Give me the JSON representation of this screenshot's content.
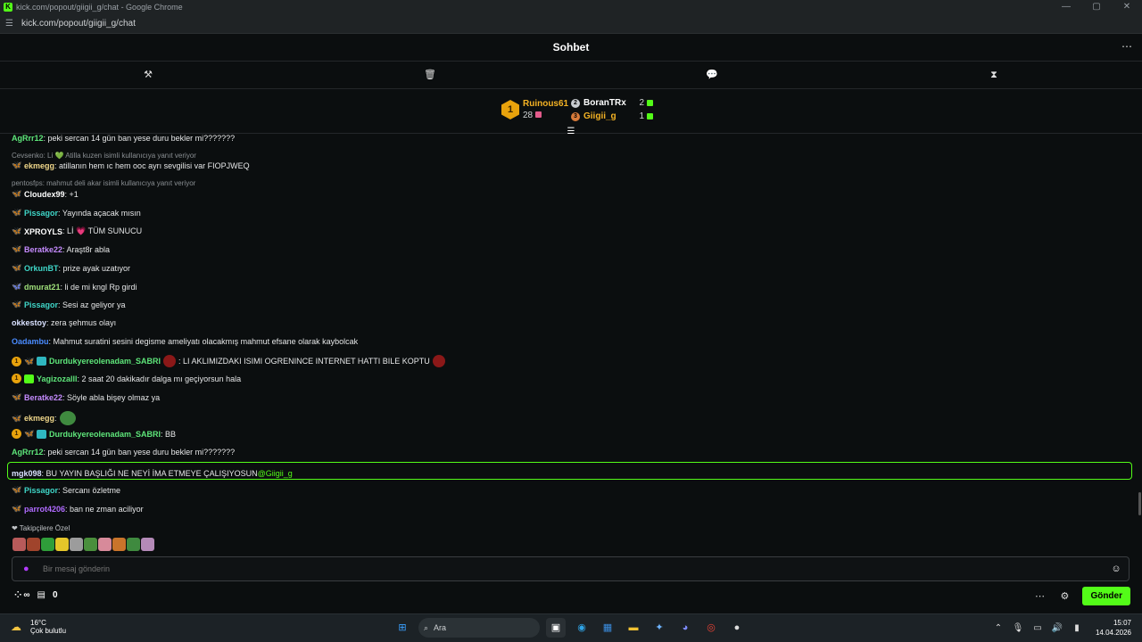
{
  "browser": {
    "title": "kick.com/popout/giigii_g/chat - Google Chrome",
    "url": "kick.com/popout/giigii_g/chat",
    "favicon_letter": "K"
  },
  "header": {
    "title": "Sohbet",
    "more": "⋯"
  },
  "toolbar": {
    "tools": [
      {
        "icon": "hammer-icon",
        "glyph": "⚒"
      },
      {
        "icon": "trash-icon",
        "glyph": "🗑"
      },
      {
        "icon": "chat-bubble-icon",
        "glyph": "💬"
      },
      {
        "icon": "hourglass-icon",
        "glyph": "⧗"
      }
    ]
  },
  "leaderboard": {
    "first": {
      "rank": "1",
      "name": "Ruinous61",
      "count": "28"
    },
    "second": {
      "name": "BoranTRx",
      "count": "2"
    },
    "third": {
      "name": "Giigii_g",
      "count": "1"
    }
  },
  "messages": [
    {
      "user": "AgRrr12",
      "color": "#5ee67a",
      "text": ": peki sercan 14 gün ban yese duru bekler mi???????",
      "badges": []
    },
    {
      "reply": "Cevsenko: Li 💚 Atilla kuzen isimli kullanıcıya yanıt veriyor"
    },
    {
      "user": "ekmegg",
      "color": "#f0d78a",
      "text": ": atillanın hem ıc hem ooc ayrı sevgilisi var FIOPJWEQ",
      "badges": [
        "fly"
      ]
    },
    {
      "reply": "pentosfps: mahmut deli akar isimli kullanıcıya yanıt veriyor"
    },
    {
      "user": "Cloudex99",
      "color": "#ffffff",
      "text": ": +1",
      "badges": [
        "fly"
      ]
    },
    {
      "user": "Pissagor",
      "color": "#3fd6c8",
      "text": ": Yayında açacak mısın",
      "badges": [
        "fly"
      ]
    },
    {
      "user": "XPROYLS",
      "color": "#ffffff",
      "text": ": Lİ 💗 TÜM SUNUCU",
      "badges": [
        "fly"
      ]
    },
    {
      "user": "Beratke22",
      "color": "#c58bff",
      "text": ": Araşt8r abla",
      "badges": [
        "fly"
      ]
    },
    {
      "user": "OrkunBT",
      "color": "#3fd6c8",
      "text": ": prize ayak uzatıyor",
      "badges": [
        "fly"
      ]
    },
    {
      "user": "dmurat21",
      "color": "#9fe07a",
      "text": ": li de mi kngl Rp girdi",
      "badges": [
        "fly-orange"
      ]
    },
    {
      "user": "Pissagor",
      "color": "#3fd6c8",
      "text": ": Sesi az geliyor ya",
      "badges": [
        "fly"
      ]
    },
    {
      "user": "okkestoy",
      "color": "#d9e1ff",
      "text": ": zera şehmus olayı",
      "badges": []
    },
    {
      "user": "Oadambu",
      "color": "#4a8cff",
      "text": ": Mahmut suratini sesini degisme ameliyatı olacakmış mahmut efsane olarak kaybolcak",
      "badges": []
    },
    {
      "user": "Durdukyereolenadam_SABRI",
      "color": "#5ee67a",
      "text": ":  LI AKLIMIZDAKI ISIMI OGRENINCE INTERNET HATTI BILE KOPTU ",
      "badges": [
        "one",
        "fly",
        "gift"
      ],
      "emotes": true
    },
    {
      "user": "Yagizozalll",
      "color": "#5ee67a",
      "text": ": 2 saat 20 dakikadır dalga mı geçiyorsun hala",
      "badges": [
        "one",
        "giftg"
      ]
    },
    {
      "user": "Beratke22",
      "color": "#c58bff",
      "text": ": Söyle abla bişey olmaz ya",
      "badges": [
        "fly"
      ]
    },
    {
      "user": "ekmegg",
      "color": "#f0d78a",
      "text": ":",
      "badges": [
        "fly"
      ],
      "pepe": true
    },
    {
      "user": "Durdukyereolenadam_SABRI",
      "color": "#5ee67a",
      "text": ": BB",
      "badges": [
        "one",
        "fly",
        "gift"
      ]
    },
    {
      "user": "AgRrr12",
      "color": "#5ee67a",
      "text": ": peki sercan 14 gün ban yese duru bekler mi???????",
      "badges": []
    },
    {
      "user": "mgk098",
      "color": "#d9e1ff",
      "text": ": BU YAYIN BAŞLIĞI NE NEYİ İMA ETMEYE ÇALIŞIYOSUN",
      "mention": "@Giigii_g",
      "badges": [],
      "highlight": true
    },
    {
      "user": "Pissagor",
      "color": "#3fd6c8",
      "text": ": Sercanı özletme",
      "badges": [
        "fly"
      ]
    },
    {
      "user": "parrot4206",
      "color": "#b06bff",
      "text": ": ban ne zman aciliyor",
      "badges": [
        "fly"
      ]
    }
  ],
  "emote_panel": {
    "label": "❤ Takipçilere Özel"
  },
  "composer": {
    "placeholder": "Bir mesaj gönderin"
  },
  "footer": {
    "infinity": "∞",
    "count": "0",
    "send_label": "Gönder"
  },
  "taskbar": {
    "temp": "16°C",
    "weather": "Çok bulutlu",
    "search": "Ara",
    "time": "15:07",
    "date": "14.04.2026"
  }
}
